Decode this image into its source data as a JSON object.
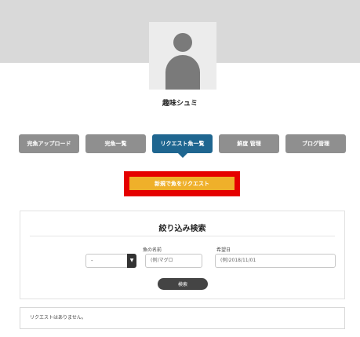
{
  "profile": {
    "username": "趣味シュミ"
  },
  "tabs": [
    {
      "label": "完魚アップロード",
      "active": false
    },
    {
      "label": "完魚一覧",
      "active": false
    },
    {
      "label": "リクエスト魚一覧",
      "active": true
    },
    {
      "label": "鮮度 管理",
      "active": false
    },
    {
      "label": "ブログ管理",
      "active": false
    }
  ],
  "request_button": {
    "label": "新規で魚をリクエスト",
    "color": "#efb02a",
    "highlight_color": "#e50000"
  },
  "filter": {
    "title": "絞り込み検索",
    "category_label": "",
    "category_value": "-",
    "fish_name_label": "魚の名前",
    "fish_name_placeholder": "(例)マグロ",
    "date_label": "希望日",
    "date_placeholder": "(例)2018/11/01",
    "search_label": "検索"
  },
  "results": {
    "empty_message": "リクエストはありません。"
  },
  "colors": {
    "banner": "#d9d9d9",
    "tab_default": "#8f8f8f",
    "tab_active": "#1f6690"
  }
}
